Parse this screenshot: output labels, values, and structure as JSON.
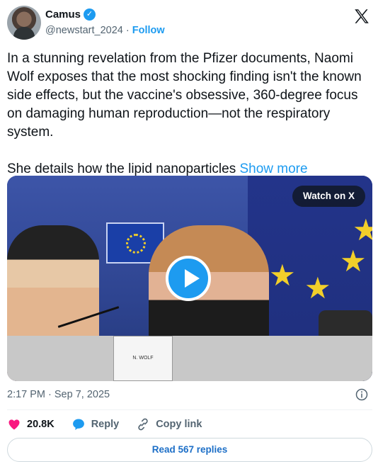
{
  "author": {
    "display_name": "Camus",
    "handle": "@newstart_2024",
    "separator": "·",
    "follow_label": "Follow",
    "verified_color": "#1d9bf0"
  },
  "tweet": {
    "text": "In a stunning revelation from the Pfizer documents, Naomi Wolf exposes that the most shocking finding isn't the known side effects, but the vaccine's obsessive, 360-degree focus on damaging human reproduction—not the respiratory system.\n\nShe details how the lipid nanoparticles ",
    "show_more_label": "Show more"
  },
  "media": {
    "watch_label": "Watch on X",
    "nameplate_text": "N. WOLF",
    "play_icon": "play-icon"
  },
  "meta": {
    "timestamp": "2:17 PM · Sep 7, 2025"
  },
  "actions": {
    "like_count": "20.8K",
    "reply_label": "Reply",
    "copy_link_label": "Copy link"
  },
  "footer": {
    "read_replies_label": "Read 567 replies"
  },
  "colors": {
    "accent": "#1d9bf0",
    "like": "#f91880",
    "muted": "#536471"
  }
}
